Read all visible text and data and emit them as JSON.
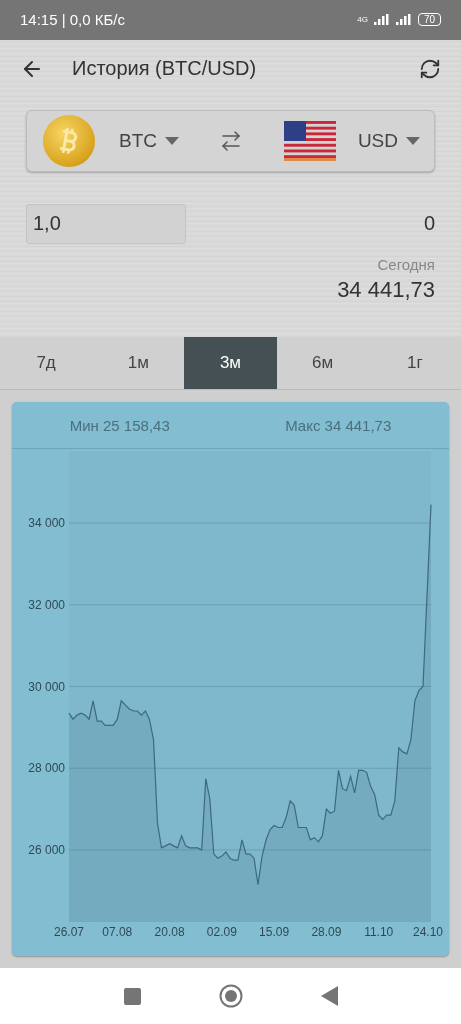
{
  "status_bar": {
    "time": "14:15 | 0,0 КБ/с",
    "network": "4G",
    "battery": "70"
  },
  "toolbar": {
    "title": "История (BTC/USD)"
  },
  "converter": {
    "from": "BTC",
    "to": "USD",
    "amount": "1,0",
    "result": "0",
    "date_label": "Сегодня",
    "rate": "34 441,73"
  },
  "periods": [
    {
      "label": "7д",
      "selected": false
    },
    {
      "label": "1м",
      "selected": false
    },
    {
      "label": "3м",
      "selected": true
    },
    {
      "label": "6м",
      "selected": false
    },
    {
      "label": "1г",
      "selected": false
    }
  ],
  "chart": {
    "min_label": "Мин 25 158,43",
    "max_label": "Макс 34 441,73",
    "chart_data": {
      "type": "area",
      "grid": true,
      "categories": [
        "26.07",
        null,
        null,
        null,
        null,
        null,
        null,
        null,
        null,
        null,
        null,
        null,
        "07.08",
        null,
        null,
        null,
        null,
        null,
        null,
        null,
        null,
        null,
        null,
        null,
        null,
        "20.08",
        null,
        null,
        null,
        null,
        null,
        null,
        null,
        null,
        null,
        null,
        null,
        null,
        "02.09",
        null,
        null,
        null,
        null,
        null,
        null,
        null,
        null,
        null,
        null,
        null,
        null,
        "15.09",
        null,
        null,
        null,
        null,
        null,
        null,
        null,
        null,
        null,
        null,
        null,
        null,
        "28.09",
        null,
        null,
        null,
        null,
        null,
        null,
        null,
        null,
        null,
        null,
        null,
        null,
        "11.10",
        null,
        null,
        null,
        null,
        null,
        null,
        null,
        null,
        null,
        null,
        null,
        null,
        "24.10"
      ],
      "series": [
        {
          "color": "#3d6a7c",
          "values": [
            29350,
            29200,
            29300,
            29350,
            29300,
            29200,
            29650,
            29150,
            29150,
            29050,
            29050,
            29050,
            29200,
            29650,
            29550,
            29450,
            29400,
            29400,
            29300,
            29400,
            29200,
            28700,
            26650,
            26050,
            26100,
            26150,
            26100,
            26050,
            26350,
            26100,
            26050,
            26050,
            26050,
            26000,
            27750,
            27250,
            25900,
            25800,
            25850,
            25950,
            25800,
            25750,
            25750,
            26250,
            25900,
            25900,
            25800,
            25150,
            25850,
            26250,
            26500,
            26600,
            26550,
            26550,
            26800,
            27200,
            27100,
            26550,
            26550,
            26550,
            26250,
            26300,
            26200,
            26350,
            27000,
            26900,
            26950,
            27950,
            27500,
            27450,
            27800,
            27400,
            27950,
            27950,
            27900,
            27550,
            27350,
            26850,
            26750,
            26850,
            26850,
            27200,
            28500,
            28400,
            28350,
            28700,
            29650,
            29900,
            30000,
            32200,
            34450
          ]
        }
      ],
      "ylim": [
        24250,
        35750
      ],
      "yticks": [
        {
          "value": 26000,
          "label": "26 000"
        },
        {
          "value": 28000,
          "label": "28 000"
        },
        {
          "value": 30000,
          "label": "30 000"
        },
        {
          "value": 32000,
          "label": "32 000"
        },
        {
          "value": 34000,
          "label": "34 000"
        }
      ]
    }
  }
}
